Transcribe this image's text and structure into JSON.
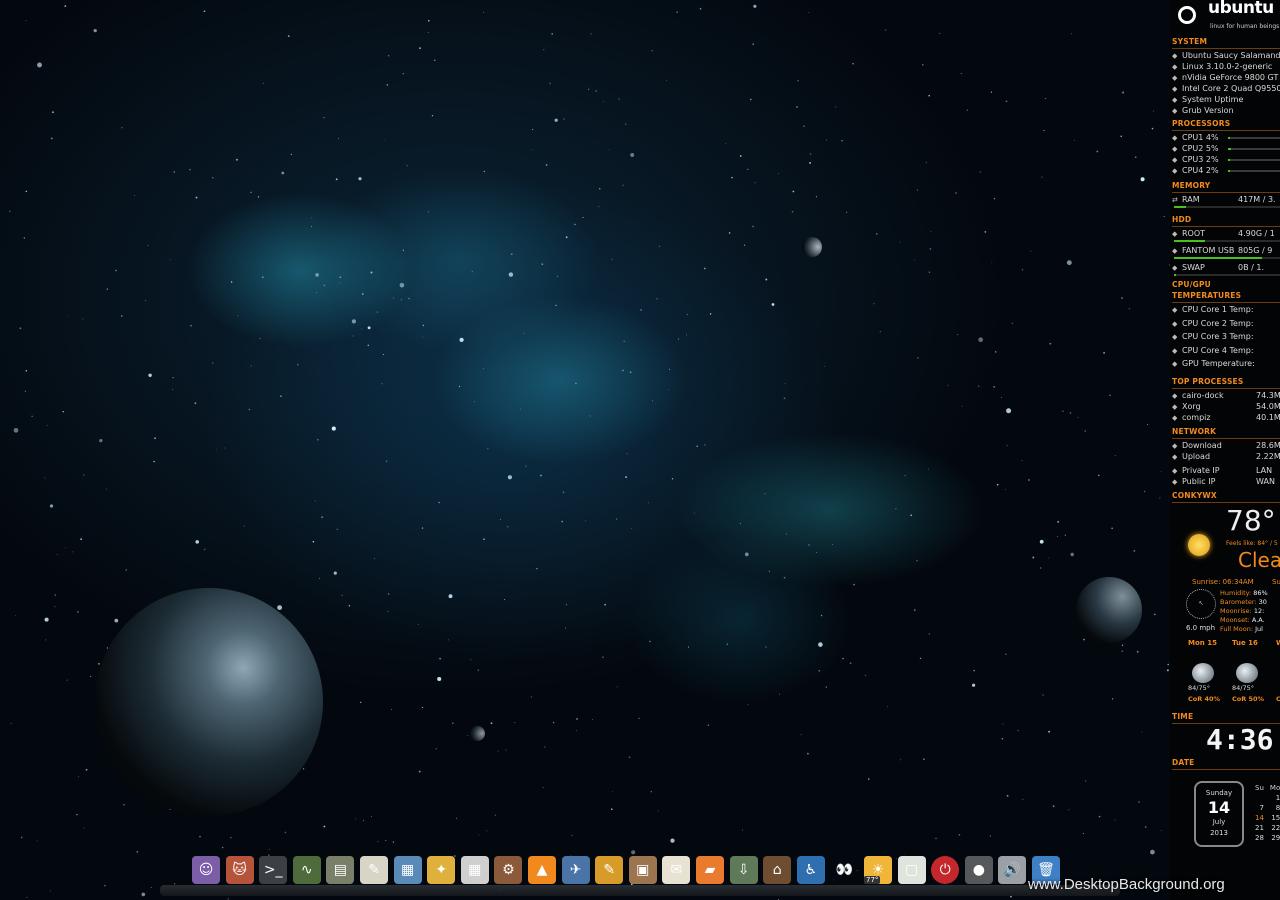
{
  "logo": {
    "name": "ubuntu",
    "tagline": "linux for human beings"
  },
  "system": {
    "title": "SYSTEM",
    "items": [
      "Ubuntu Saucy Salamander",
      "Linux 3.10.0-2-generic",
      "nVidia GeForce 9800 GT",
      "Intel Core 2 Quad Q9550",
      "System Uptime",
      "Grub Version"
    ]
  },
  "processors": {
    "title": "PROCESSORS",
    "items": [
      {
        "label": "CPU1",
        "pct": "4%",
        "level": 0.04
      },
      {
        "label": "CPU2",
        "pct": "5%",
        "level": 0.05
      },
      {
        "label": "CPU3",
        "pct": "2%",
        "level": 0.02
      },
      {
        "label": "CPU4",
        "pct": "2%",
        "level": 0.02
      }
    ]
  },
  "memory": {
    "title": "MEMORY",
    "label": "RAM",
    "value": "417M   / 3.",
    "level": 0.12
  },
  "hdd": {
    "title": "HDD",
    "items": [
      {
        "label": "ROOT",
        "value": "4.90G  / 1",
        "level": 0.3
      },
      {
        "label": "FANTOM USB",
        "value": "805G  / 9",
        "level": 0.85
      },
      {
        "label": "SWAP",
        "value": "0B    / 1.",
        "level": 0.0
      }
    ]
  },
  "temps": {
    "title": "CPU/GPU TEMPERATURES",
    "items": [
      "CPU Core 1 Temp:",
      "CPU Core 2 Temp:",
      "CPU Core 3 Temp:",
      "CPU Core 4 Temp:",
      "GPU Temperature:"
    ]
  },
  "processes": {
    "title": "TOP PROCESSES",
    "items": [
      {
        "name": "cairo-dock",
        "mem": "74.3M"
      },
      {
        "name": "Xorg",
        "mem": "54.0M"
      },
      {
        "name": "compiz",
        "mem": "40.1M"
      }
    ]
  },
  "network": {
    "title": "NETWORK",
    "items": [
      {
        "label": "Download",
        "value": "28.6M"
      },
      {
        "label": "Upload",
        "value": "2.22M"
      },
      {
        "label": "Private IP",
        "value": "LAN"
      },
      {
        "label": "Public  IP",
        "value": "WAN"
      }
    ]
  },
  "weather": {
    "title": "CONKYWX",
    "temp": "78°",
    "feels": "Feels like: 84° / 5",
    "condition": "Clea",
    "sunrise": "Sunrise: 06:34AM",
    "sunset": "Su",
    "wind_speed": "6.0  mph",
    "details": [
      {
        "k": "Humidity:",
        "v": "86%"
      },
      {
        "k": "Barometer:",
        "v": "30"
      },
      {
        "k": "Moonrise:",
        "v": "12:"
      },
      {
        "k": "Moonset:",
        "v": "A.A."
      },
      {
        "k": "Full Moon:",
        "v": "Jul"
      }
    ],
    "forecast": [
      {
        "day": "Mon 15",
        "temp": "84/75°",
        "cor": "CoR 40%"
      },
      {
        "day": "Tue 16",
        "temp": "84/75°",
        "cor": "CoR 50%"
      },
      {
        "day": "W",
        "temp": "",
        "cor": "C"
      }
    ]
  },
  "time": {
    "title": "TIME",
    "value": "4:36"
  },
  "date": {
    "title": "DATE",
    "weekday": "Sunday",
    "day": "14",
    "month": "July",
    "year": "2013",
    "cal_head": [
      "Su",
      "Mo"
    ],
    "cal_rows": [
      [
        "",
        "1"
      ],
      [
        "7",
        "8"
      ],
      [
        "14",
        "15"
      ],
      [
        "21",
        "22"
      ],
      [
        "28",
        "29"
      ]
    ]
  },
  "dock": {
    "items": [
      "user-icon",
      "cat-app-icon",
      "terminal-icon",
      "system-monitor-icon",
      "archive-icon",
      "text-editor-icon",
      "image-viewer-icon",
      "cleaner-icon",
      "calculator-icon",
      "tools-icon",
      "vlc-icon",
      "bird-app-icon",
      "brush-icon",
      "box-icon",
      "notes-icon",
      "folder-icon",
      "installer-icon",
      "home-icon",
      "accessibility-icon",
      "eyes-icon",
      "weather-icon",
      "window-icon",
      "power-icon",
      "disc-icon",
      "volume-icon",
      "trash-icon"
    ],
    "weather_badge": "77°"
  },
  "watermark": "www.DesktopBackground.org",
  "colors": {
    "accent": "#f08a1f",
    "bar": "#46c21a",
    "background": "#03080e"
  }
}
